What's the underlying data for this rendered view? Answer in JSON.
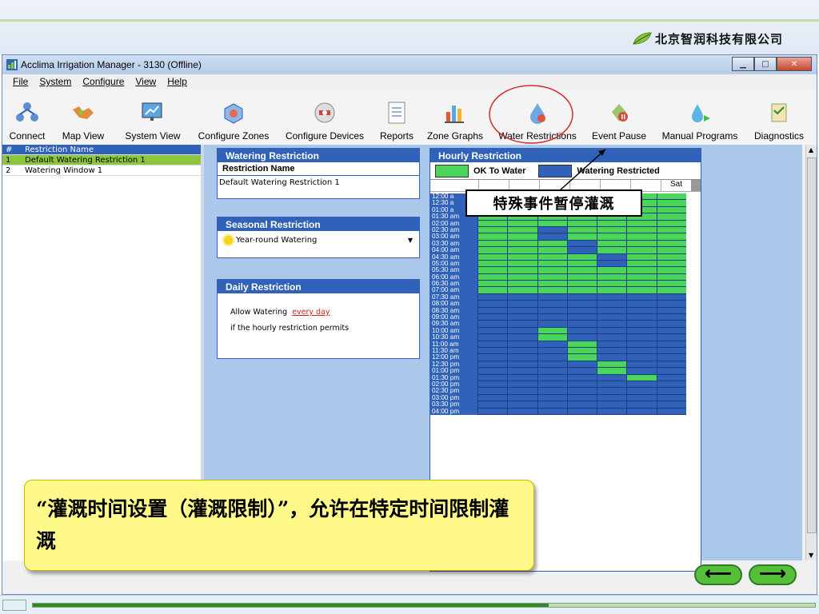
{
  "logo_text": "北京智润科技有限公司",
  "window": {
    "title": "Acclima Irrigation Manager - 3130 (Offline)"
  },
  "menu": [
    "File",
    "System",
    "Configure",
    "View",
    "Help"
  ],
  "toolbar": [
    "Connect",
    "Map View",
    "System View",
    "Configure Zones",
    "Configure Devices",
    "Reports",
    "Zone Graphs",
    "Water Restrictions",
    "Event Pause",
    "Manual Programs",
    "Diagnostics"
  ],
  "list": {
    "header_num": "#",
    "header_name": "Restriction Name",
    "rows": [
      {
        "num": "1",
        "name": "Default Watering Restriction 1"
      },
      {
        "num": "2",
        "name": "Watering Window 1"
      }
    ]
  },
  "watering_restriction": {
    "title": "Watering Restriction",
    "name_label": "Restriction Name",
    "name_value": "Default Watering Restriction 1"
  },
  "seasonal": {
    "title": "Seasonal Restriction",
    "value": "Year-round Watering"
  },
  "daily": {
    "title": "Daily Restriction",
    "text1": "Allow Watering",
    "link": "every day",
    "text2": "if the hourly restriction permits"
  },
  "hourly": {
    "title": "Hourly Restriction",
    "ok_label": "OK To Water",
    "restricted_label": "Watering Restricted",
    "last_day": "Sat",
    "colors": {
      "ok": "#49d65a",
      "restricted": "#2f62b8"
    },
    "times": [
      "12:00 a",
      "12:30 a",
      "01:00 a",
      "01:30 am",
      "02:00 am",
      "02:30 am",
      "03:00 am",
      "03:30 am",
      "04:00 am",
      "04:30 am",
      "05:00 am",
      "05:30 am",
      "06:00 am",
      "06:30 am",
      "07:00 am",
      "07:30 am",
      "08:00 am",
      "08:30 am",
      "09:00 am",
      "09:30 am",
      "10:00 am",
      "10:30 am",
      "11:00 am",
      "11:30 am",
      "12:00 pm",
      "12:30 pm",
      "01:00 pm",
      "01:30 pm",
      "02:00 pm",
      "02:30 pm",
      "03:00 pm",
      "03:30 pm",
      "04:00 pm"
    ],
    "grid": [
      "1111111",
      "1111111",
      "1111111",
      "1111111",
      "1111111",
      "1101111",
      "1101111",
      "1110111",
      "1110111",
      "1111011",
      "1111011",
      "1111111",
      "1111111",
      "1111111",
      "1111111",
      "0000000",
      "0000000",
      "0000000",
      "0000000",
      "0000000",
      "0010000",
      "0010000",
      "0001000",
      "0001000",
      "0001000",
      "0000100",
      "0000100",
      "0000010",
      "0000000",
      "0000000",
      "0000000",
      "0000000",
      "0000000"
    ]
  },
  "callout": "特殊事件暂停灌溉",
  "note": "“灌溉时间设置（灌溉限制）”，允许在特定时间限制灌溉",
  "nav": {
    "prev": "⟵",
    "next": "⟶"
  }
}
